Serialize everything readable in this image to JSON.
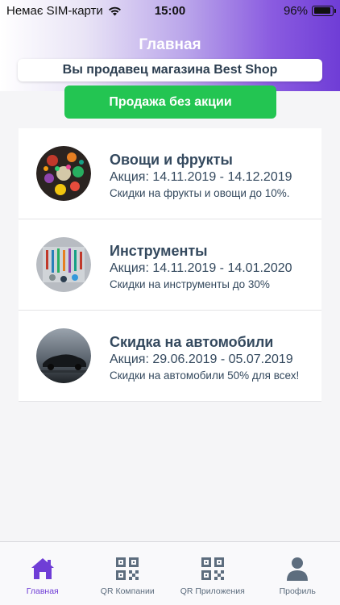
{
  "status_bar": {
    "carrier": "Немає SIM-карти",
    "time": "15:00",
    "battery": "96%",
    "battery_level": 0.96
  },
  "header": {
    "title": "Главная",
    "shop_banner": "Вы продавец магазина Best Shop",
    "sale_button": "Продажа без акции"
  },
  "promotions": [
    {
      "title": "Овощи и фрукты",
      "dates": "Акция: 14.11.2019 - 14.12.2019",
      "description": "Скидки на фрукты и овощи до 10%.",
      "icon": "vegetables-fruits-photo"
    },
    {
      "title": "Инструменты",
      "dates": "Акция: 14.11.2019 - 14.01.2020",
      "description": "Скидки на инструменты до 30%",
      "icon": "tools-photo"
    },
    {
      "title": "Скидка на автомобили",
      "dates": "Акция: 29.06.2019 - 05.07.2019",
      "description": "Скидки на автомобили 50% для всех!",
      "icon": "car-photo"
    }
  ],
  "tab_bar": {
    "tabs": [
      {
        "label": "Главная",
        "icon": "home-icon",
        "active": true
      },
      {
        "label": "QR Компании",
        "icon": "qr-code-icon",
        "active": false
      },
      {
        "label": "QR Приложения",
        "icon": "qr-code-icon",
        "active": false
      },
      {
        "label": "Профиль",
        "icon": "person-icon",
        "active": false
      }
    ]
  },
  "colors": {
    "accent": "#6f3dd6",
    "sale_button": "#23c552",
    "text": "#34495e"
  }
}
